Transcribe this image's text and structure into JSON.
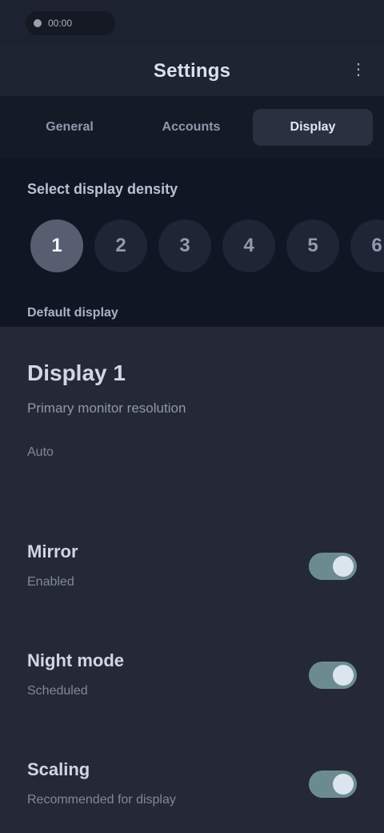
{
  "status": {
    "label": "00:00"
  },
  "header": {
    "title": "Settings",
    "menu_icon": "more-vert-icon"
  },
  "tabs": [
    {
      "label": "General",
      "active": false
    },
    {
      "label": "Accounts",
      "active": false
    },
    {
      "label": "Display",
      "active": true
    }
  ],
  "options": {
    "title": "Select display density",
    "chips": [
      "1",
      "2",
      "3",
      "4",
      "5",
      "6"
    ],
    "selected_index": 0,
    "footer": "Default display"
  },
  "profile": {
    "name": "Display 1",
    "description": "Primary monitor resolution",
    "meta": "Auto"
  },
  "settings": [
    {
      "title": "Mirror",
      "subtitle": "Enabled",
      "toggle_on": true
    },
    {
      "title": "Night mode",
      "subtitle": "Scheduled",
      "toggle_on": true
    },
    {
      "title": "Scaling",
      "subtitle": "Recommended for display",
      "toggle_on": true
    }
  ]
}
